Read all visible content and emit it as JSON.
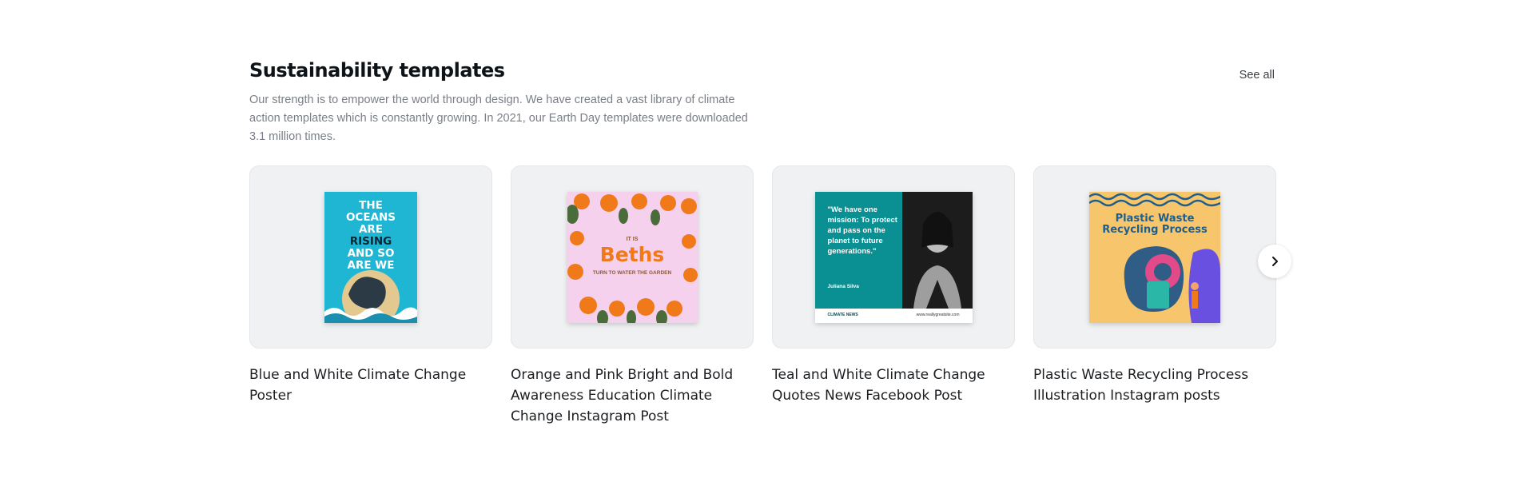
{
  "section": {
    "title": "Sustainability templates",
    "description": "Our strength is to empower the world through design. We have created a vast library of climate action templates which is constantly growing. In 2021, our Earth Day templates were downloaded 3.1 million times.",
    "see_all_label": "See all",
    "next_icon": "chevron-right-icon"
  },
  "cards": [
    {
      "label": "Blue and White Climate Change Poster",
      "art_lines": [
        "THE",
        "OCEANS",
        "ARE",
        "RISING",
        "AND SO",
        "ARE WE"
      ]
    },
    {
      "label": "Orange and Pink Bright and Bold Awareness Education Climate Change Instagram Post",
      "art_small": "IT IS",
      "art_big": "Beths",
      "art_sub": "TURN TO WATER THE GARDEN"
    },
    {
      "label": "Teal and White Climate Change Quotes News Facebook Post",
      "art_quote": "\"We have one mission: To protect and pass on the planet to future generations.\"",
      "art_name": "Juliana Silva",
      "art_footer_brand": "CLIMATE NEWS",
      "art_footer_url": "www.reallygreatsite.com"
    },
    {
      "label": "Plastic Waste Recycling Process Illustration Instagram posts",
      "art_title": "Plastic Waste Recycling Process"
    }
  ],
  "colors": {
    "accent_teal": "#0a8f93",
    "ocean_blue": "#1fb6d4",
    "orange": "#f07a1a",
    "pink": "#f6d1ee",
    "yellow": "#f6c56c"
  }
}
